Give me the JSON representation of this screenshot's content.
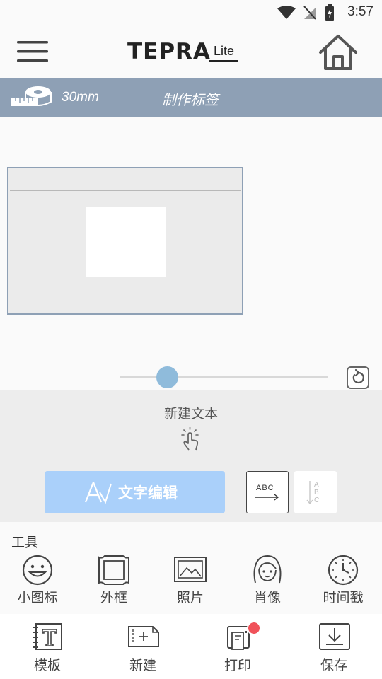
{
  "status_bar": {
    "time": "3:57"
  },
  "header": {
    "logo_main": "TEPRA",
    "logo_sub": "Lite",
    "menu_icon": "hamburger-menu-icon",
    "home_icon": "home-icon"
  },
  "label_bar": {
    "tape_size": "30mm",
    "title": "制作标签"
  },
  "editor": {
    "zoom_level": 0.23,
    "new_text": "新建文本",
    "edit_text_button": "文字编辑",
    "horizontal_icon_text": "ABC",
    "vertical_icon_text": "ABC"
  },
  "tools": {
    "title": "工具",
    "items": [
      {
        "label": "小图标",
        "icon": "smiley-icon"
      },
      {
        "label": "外框",
        "icon": "frame-icon"
      },
      {
        "label": "照片",
        "icon": "photo-icon"
      },
      {
        "label": "肖像",
        "icon": "portrait-icon"
      },
      {
        "label": "时间戳",
        "icon": "clock-icon"
      }
    ]
  },
  "bottom_nav": {
    "items": [
      {
        "label": "模板",
        "icon": "template-icon"
      },
      {
        "label": "新建",
        "icon": "new-label-icon"
      },
      {
        "label": "打印",
        "icon": "printer-icon"
      },
      {
        "label": "保存",
        "icon": "save-icon"
      }
    ]
  },
  "colors": {
    "label_bar": "#8ea0b5",
    "edit_button": "#aad0fa",
    "slider_thumb": "#8fbbdb",
    "notification_badge": "#f0525a"
  }
}
